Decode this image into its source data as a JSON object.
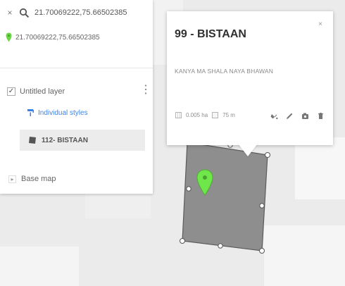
{
  "search": {
    "query": "21.70069222,75.66502385",
    "result": "21.70069222,75.66502385"
  },
  "layers": {
    "layer_name": "Untitled layer",
    "styles_label": "Individual styles",
    "feature_name": "112- BISTAAN",
    "base_map_label": "Base map",
    "layer_checked": true
  },
  "popup": {
    "title": "99 - BISTAAN",
    "description": "KANYA MA SHALA NAYA BHAWAN",
    "area": "0.005 ha",
    "length": "75 m"
  },
  "colors": {
    "accent_blue": "#3d83e6",
    "pin_green": "#6fe64a",
    "polygon_fill": "#8e8e8e"
  },
  "icons": {
    "close": "close-icon",
    "search": "search-icon",
    "location_pin": "location-pin-icon",
    "menu": "kebab-menu-icon",
    "paint": "paint-roller-icon",
    "polygon": "polygon-icon",
    "basemap": "expand-icon",
    "style": "paint-bucket-icon",
    "edit": "pencil-icon",
    "camera": "camera-icon",
    "delete": "trash-icon"
  }
}
